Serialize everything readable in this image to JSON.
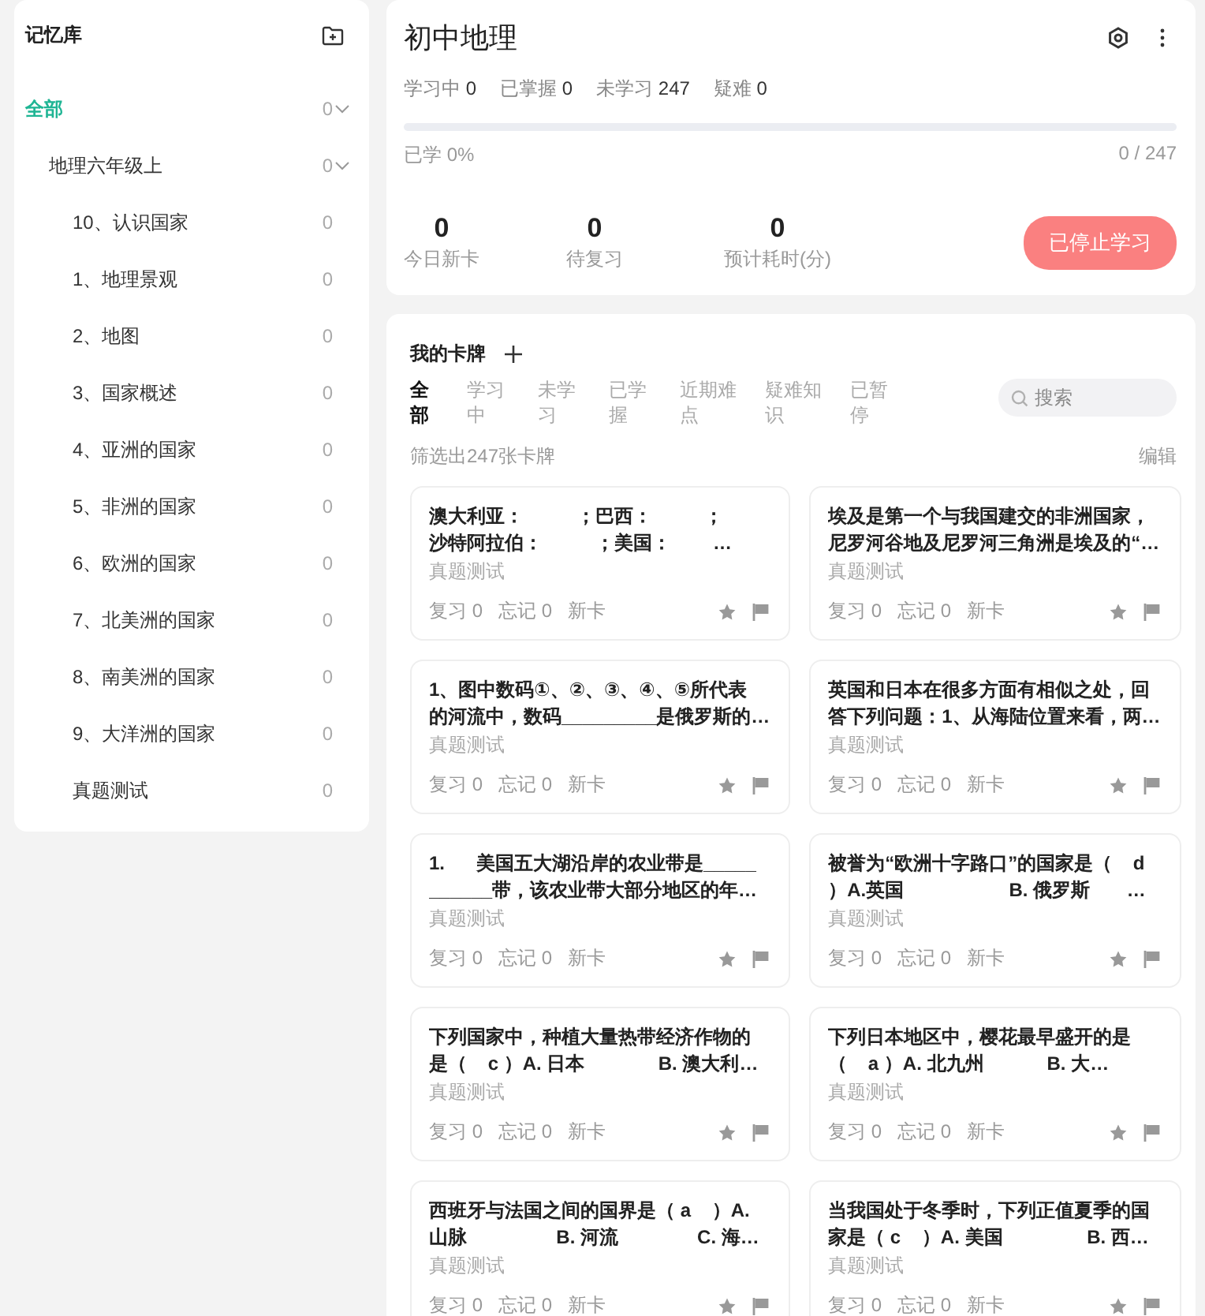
{
  "sidebar": {
    "title": "记忆库",
    "tree": [
      {
        "label": "全部",
        "count": "0",
        "selected": true,
        "expanded": true,
        "children": [
          {
            "label": "地理六年级上",
            "count": "0",
            "selected": false,
            "expanded": true,
            "children": [
              {
                "label": "10、认识国家",
                "count": "0",
                "selected": false
              },
              {
                "label": "1、地理景观",
                "count": "0",
                "selected": false
              },
              {
                "label": "2、地图",
                "count": "0",
                "selected": false
              },
              {
                "label": "3、国家概述",
                "count": "0",
                "selected": false
              },
              {
                "label": "4、亚洲的国家",
                "count": "0",
                "selected": false
              },
              {
                "label": "5、非洲的国家",
                "count": "0",
                "selected": false
              },
              {
                "label": "6、欧洲的国家",
                "count": "0",
                "selected": false
              },
              {
                "label": "7、北美洲的国家",
                "count": "0",
                "selected": false
              },
              {
                "label": "8、南美洲的国家",
                "count": "0",
                "selected": false
              },
              {
                "label": "9、大洋洲的国家",
                "count": "0",
                "selected": false
              },
              {
                "label": "真题测试",
                "count": "0",
                "selected": false
              }
            ]
          }
        ]
      }
    ]
  },
  "deck": {
    "title": "初中地理",
    "stats": [
      {
        "label": "学习中",
        "value": "0"
      },
      {
        "label": "已掌握",
        "value": "0"
      },
      {
        "label": "未学习",
        "value": "247"
      },
      {
        "label": "疑难",
        "value": "0"
      }
    ],
    "progress": {
      "level": 0,
      "label": "已学 0%",
      "reading": "0 / 247"
    },
    "summary": [
      {
        "value": "0",
        "label": "今日新卡"
      },
      {
        "value": "0",
        "label": "待复习"
      },
      {
        "value": "0",
        "label": "预计耗时(分)"
      }
    ],
    "button": "已停止学习"
  },
  "cards_panel": {
    "title": "我的卡牌",
    "tabs": [
      {
        "label": "全部",
        "selected": true
      },
      {
        "label": "学习中",
        "selected": false
      },
      {
        "label": "未学习",
        "selected": false
      },
      {
        "label": "已学握",
        "selected": false
      },
      {
        "label": "近期难点",
        "selected": false
      },
      {
        "label": "疑难知识",
        "selected": false
      },
      {
        "label": "已暂停",
        "selected": false
      }
    ],
    "search": {
      "placeholder": "搜索"
    },
    "filter_count": "筛选出247张卡牌",
    "edit": "编辑",
    "cards": [
      {
        "lines": [
          "澳大利亚：          ；巴西：          ；",
          "沙特阿拉伯：          ；美国：        …"
        ],
        "tag": "真题测试",
        "review": "复习 0",
        "forget": "忘记 0",
        "status": "新卡"
      },
      {
        "lines": [
          "埃及是第一个与我国建交的非洲国家，",
          "尼罗河谷地及尼罗河三角洲是埃及的“…"
        ],
        "tag": "真题测试",
        "review": "复习 0",
        "forget": "忘记 0",
        "status": "新卡"
      },
      {
        "lines": [
          "1、图中数码①、②、③、④、⑤所代表",
          "的河流中，数码_________是俄罗斯的…"
        ],
        "tag": "真题测试",
        "review": "复习 0",
        "forget": "忘记 0",
        "status": "新卡"
      },
      {
        "lines": [
          "英国和日本在很多方面有相似之处，回",
          "答下列问题：1、从海陆位置来看，两…"
        ],
        "tag": "真题测试",
        "review": "复习 0",
        "forget": "忘记 0",
        "status": "新卡"
      },
      {
        "lines": [
          "1.      美国五大湖沿岸的农业带是_____",
          "______带，该农业带大部分地区的年…"
        ],
        "tag": "真题测试",
        "review": "复习 0",
        "forget": "忘记 0",
        "status": "新卡"
      },
      {
        "lines": [
          "被誉为“欧洲十字路口”的国家是（    d",
          "）A.英国                    B. 俄罗斯       …"
        ],
        "tag": "真题测试",
        "review": "复习 0",
        "forget": "忘记 0",
        "status": "新卡"
      },
      {
        "lines": [
          "下列国家中，种植大量热带经济作物的",
          "是（    c ）A. 日本              B. 澳大利…"
        ],
        "tag": "真题测试",
        "review": "复习 0",
        "forget": "忘记 0",
        "status": "新卡"
      },
      {
        "lines": [
          "下列日本地区中，樱花最早盛开的是",
          "（    a ）A. 北九州            B. 大…"
        ],
        "tag": "真题测试",
        "review": "复习 0",
        "forget": "忘记 0",
        "status": "新卡"
      },
      {
        "lines": [
          "西班牙与法国之间的国界是（ a    ）A.",
          "山脉                 B. 河流               C. 海…"
        ],
        "tag": "真题测试",
        "review": "复习 0",
        "forget": "忘记 0",
        "status": "新卡"
      },
      {
        "lines": [
          "当我国处于冬季时，下列正值夏季的国",
          "家是（ c    ）A. 美国                B. 西…"
        ],
        "tag": "真题测试",
        "review": "复习 0",
        "forget": "忘记 0",
        "status": "新卡"
      }
    ]
  }
}
